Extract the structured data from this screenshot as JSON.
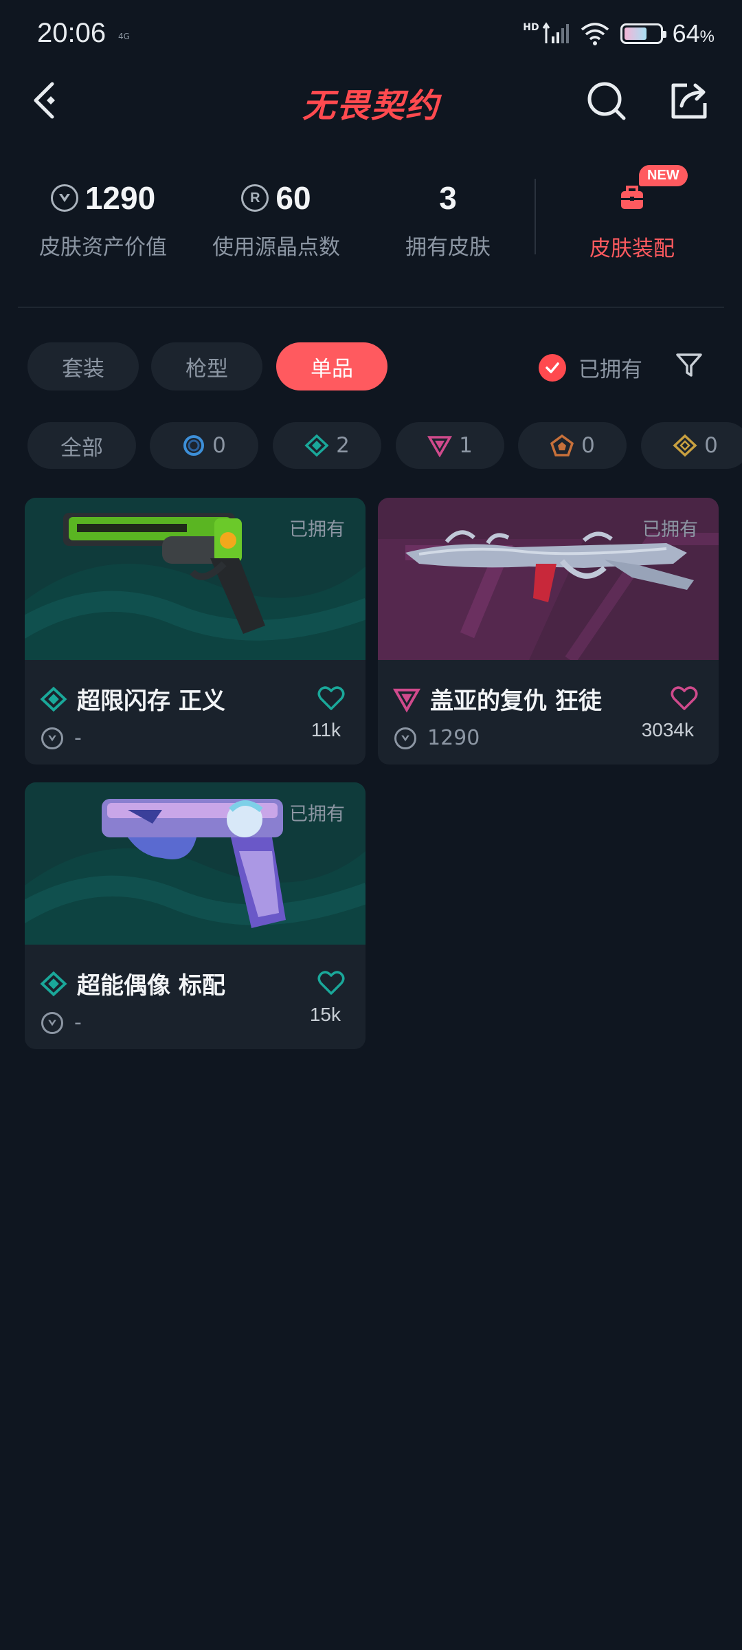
{
  "status_bar": {
    "time": "20:06",
    "mini": "4G",
    "hd": "HD",
    "battery_pct": "64",
    "battery_unit": "%",
    "battery_level": 0.64
  },
  "nav": {
    "title": "无畏契约"
  },
  "stats": [
    {
      "value": "1290",
      "label": "皮肤资产价值",
      "icon": "valorant-points-icon"
    },
    {
      "value": "60",
      "label": "使用源晶点数",
      "icon": "radianite-icon",
      "icon_glyph": "R"
    },
    {
      "value": "3",
      "label": "拥有皮肤"
    }
  ],
  "loadout": {
    "label": "皮肤装配",
    "badge": "NEW"
  },
  "tabs": [
    {
      "label": "套装",
      "active": false
    },
    {
      "label": "枪型",
      "active": false
    },
    {
      "label": "单品",
      "active": true
    }
  ],
  "owned_filter": {
    "label": "已拥有",
    "checked": true
  },
  "rarity_chips": [
    {
      "label": "全部"
    },
    {
      "count": "0",
      "icon": "select-tier-icon",
      "color": "#3d8fd8"
    },
    {
      "count": "2",
      "icon": "deluxe-tier-icon",
      "color": "#1aa89a"
    },
    {
      "count": "1",
      "icon": "premium-tier-icon",
      "color": "#d04a8c"
    },
    {
      "count": "0",
      "icon": "ultra-tier-icon",
      "color": "#c7703a"
    },
    {
      "count": "0",
      "icon": "exclusive-tier-icon",
      "color": "#c8a040"
    }
  ],
  "skins": [
    {
      "name": "超限闪存 正义",
      "owned_label": "已拥有",
      "price": "-",
      "likes": "11k",
      "tier": "deluxe",
      "tier_color": "#1aa89a",
      "heart_color": "#1aa89a"
    },
    {
      "name": "盖亚的复仇 狂徒",
      "owned_label": "已拥有",
      "price": "1290",
      "likes": "3034k",
      "tier": "premium",
      "tier_color": "#d04a8c",
      "heart_color": "#d04a8c"
    },
    {
      "name": "超能偶像 标配",
      "owned_label": "已拥有",
      "price": "-",
      "likes": "15k",
      "tier": "deluxe",
      "tier_color": "#1aa89a",
      "heart_color": "#1aa89a"
    }
  ]
}
